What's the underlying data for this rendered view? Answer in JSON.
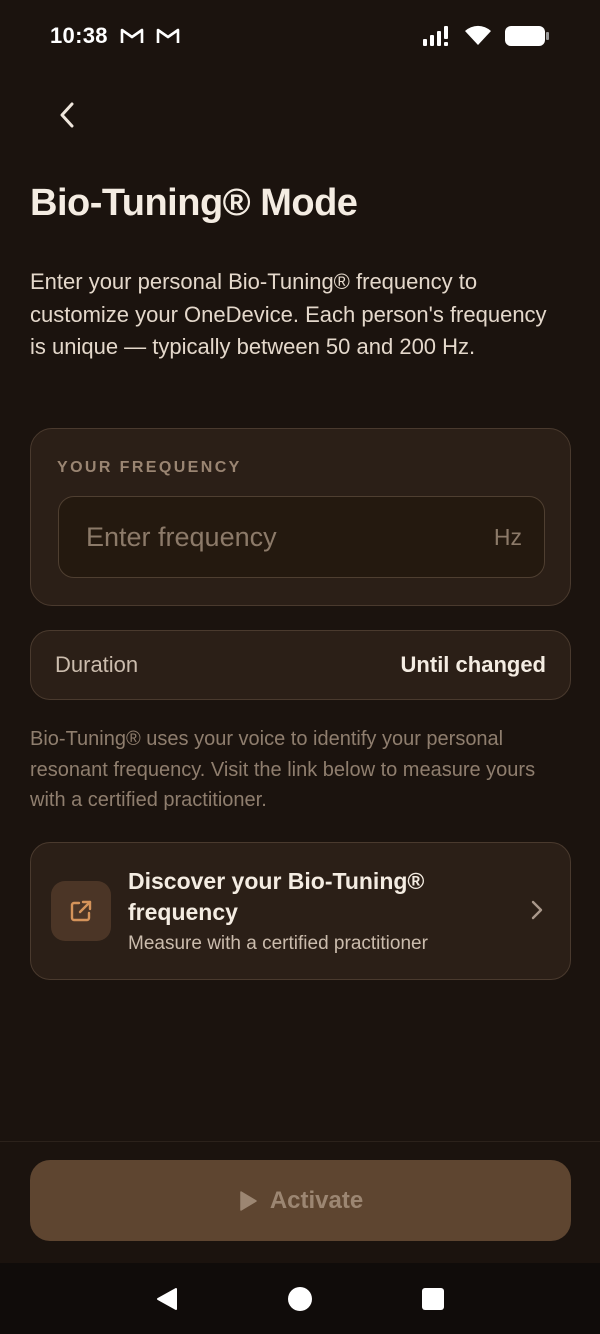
{
  "status_bar": {
    "time": "10:38",
    "notification_icons": [
      "gmail-icon",
      "gmail-icon"
    ],
    "right_icons": [
      "signal-icon",
      "wifi-icon",
      "battery-icon"
    ]
  },
  "header": {
    "back_icon": "chevron-left-icon",
    "title": "Bio-Tuning® Mode"
  },
  "intro_text": "Enter your personal Bio-Tuning® frequency to customize your OneDevice. Each person's frequency is unique — typically between 50 and 200 Hz.",
  "frequency": {
    "label": "YOUR FREQUENCY",
    "value": "",
    "placeholder": "Enter frequency",
    "unit": "Hz"
  },
  "duration": {
    "label": "Duration",
    "value": "Until changed"
  },
  "info_text": "Bio-Tuning® uses your voice to identify your personal resonant frequency. Visit the link below to measure yours with a certified practitioner.",
  "discover": {
    "icon": "external-link-icon",
    "title": "Discover your Bio-Tuning® frequency",
    "subtitle": "Measure with a certified practitioner",
    "chevron_icon": "chevron-right-icon"
  },
  "activate": {
    "icon": "play-icon",
    "label": "Activate"
  },
  "nav": [
    "back-triangle-icon",
    "home-circle-icon",
    "recents-square-icon"
  ],
  "colors": {
    "background": "#1b130e",
    "card": "#2b1f17",
    "accent": "#d4935a",
    "button_disabled": "#5e4530"
  }
}
